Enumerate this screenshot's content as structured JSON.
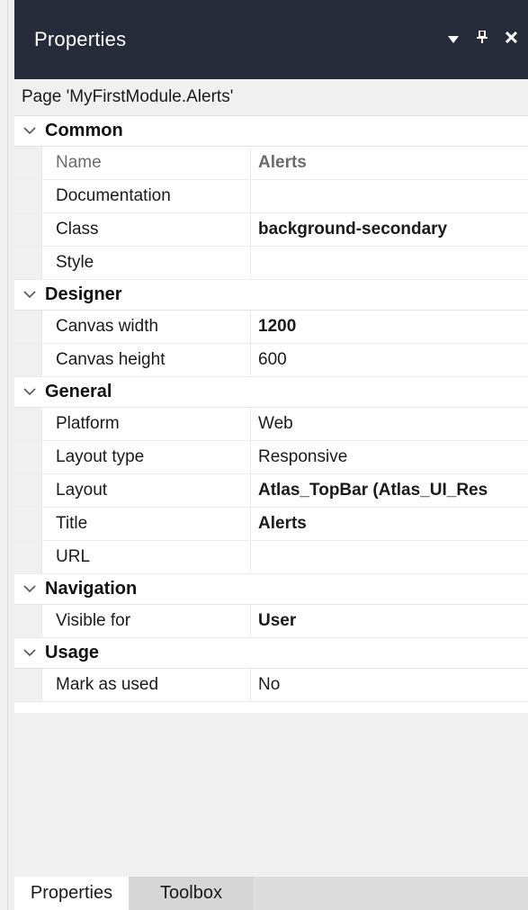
{
  "panel": {
    "title": "Properties",
    "icons": [
      "dropdown-arrow-icon",
      "pin-icon",
      "close-icon"
    ]
  },
  "caption": "Page 'MyFirstModule.Alerts'",
  "categories": [
    {
      "label": "Common",
      "rows": [
        {
          "key": "Name",
          "value": "Alerts",
          "bold": true,
          "muted": true
        },
        {
          "key": "Documentation",
          "value": ""
        },
        {
          "key": "Class",
          "value": "background-secondary",
          "bold": true
        },
        {
          "key": "Style",
          "value": ""
        }
      ]
    },
    {
      "label": "Designer",
      "rows": [
        {
          "key": "Canvas width",
          "value": "1200",
          "bold": true
        },
        {
          "key": "Canvas height",
          "value": "600"
        }
      ]
    },
    {
      "label": "General",
      "rows": [
        {
          "key": "Platform",
          "value": "Web"
        },
        {
          "key": "Layout type",
          "value": "Responsive"
        },
        {
          "key": "Layout",
          "value": "Atlas_TopBar (Atlas_UI_Res",
          "bold": true
        },
        {
          "key": "Title",
          "value": "Alerts",
          "bold": true
        },
        {
          "key": "URL",
          "value": ""
        }
      ]
    },
    {
      "label": "Navigation",
      "rows": [
        {
          "key": "Visible for",
          "value": "User",
          "bold": true
        }
      ]
    },
    {
      "label": "Usage",
      "rows": [
        {
          "key": "Mark as used",
          "value": "No"
        }
      ]
    }
  ],
  "tabs": [
    {
      "label": "Properties",
      "active": true
    },
    {
      "label": "Toolbox",
      "active": false
    }
  ],
  "colors": {
    "titlebar": "#252b39",
    "background": "#f0f0f0"
  }
}
